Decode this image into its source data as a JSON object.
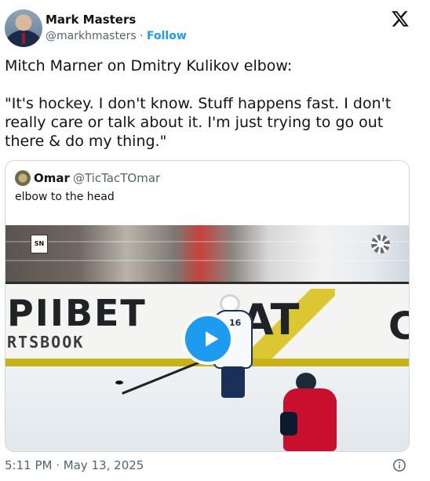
{
  "author": {
    "name": "Mark Masters",
    "handle": "@markhmasters",
    "separator": "·",
    "follow_label": "Follow",
    "avatar_icon": "avatar-photo"
  },
  "brand_icon": "x-logo-icon",
  "tweet": {
    "text": "Mitch Marner on Dmitry Kulikov elbow:\n\n\"It's hockey. I don't know. Stuff happens fast. I don't really care or talk about it. I'm just trying to go out there & do my thing.\""
  },
  "quoted": {
    "name": "Omar",
    "handle": "@TicTacTOmar",
    "text": "elbow to the head",
    "video": {
      "board_left_big": "PIIBET",
      "board_left_small": "RTSBOOK",
      "board_right": "AT",
      "board_far_right": "C",
      "jersey_number": "16",
      "broadcaster_badge": "SN",
      "play_icon": "play-icon"
    }
  },
  "footer": {
    "timestamp": "5:11 PM · May 13, 2025",
    "info_icon": "info-icon"
  },
  "colors": {
    "accent": "#1d9bf0",
    "text": "#0f1419",
    "muted": "#536471",
    "border": "#cfd9de"
  }
}
